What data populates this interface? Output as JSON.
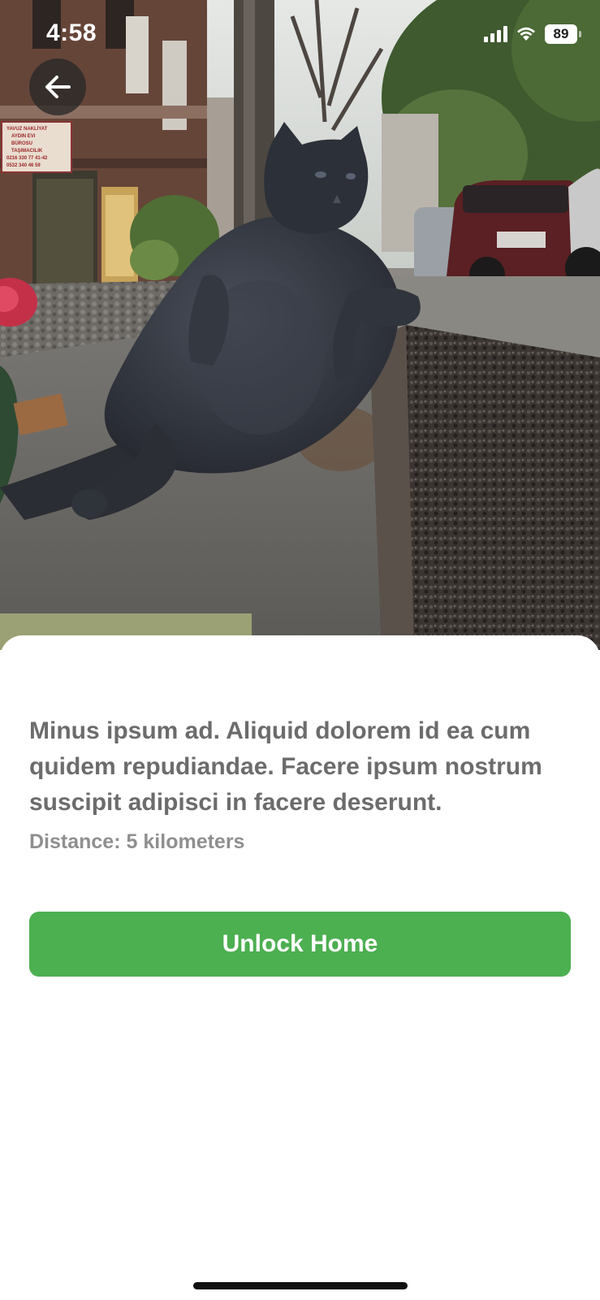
{
  "status_bar": {
    "time": "4:58",
    "battery": "89",
    "icons": [
      "signal-icon",
      "wifi-icon",
      "battery-icon"
    ]
  },
  "hero": {
    "image": "bronze-cat-statue-photo",
    "sign_lines": [
      "YAVUZ NAKLİYAT",
      "AYDIN EVI",
      "BÜROSU",
      "TAŞIMACILIK",
      "0216 330 77 41-42",
      "0532 340 46 59"
    ]
  },
  "back_button": {
    "icon": "arrow-left-icon"
  },
  "details": {
    "description": "Minus ipsum ad. Aliquid dolorem id ea cum quidem repudiandae. Facere ipsum nostrum suscipit adipisci in facere deserunt.",
    "distance_label": "Distance:",
    "distance_value": "5 kilometers"
  },
  "actions": {
    "unlock_label": "Unlock Home"
  },
  "colors": {
    "accent": "#4caf50",
    "text_primary": "#6c6c6c",
    "text_secondary": "#8f8f8f"
  }
}
